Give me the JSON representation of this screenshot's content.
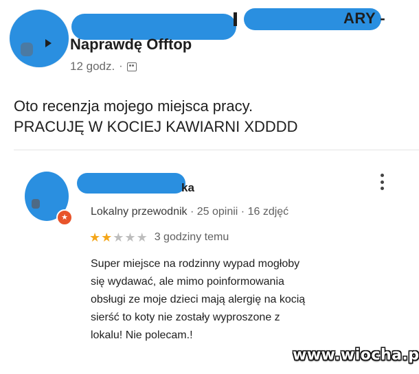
{
  "post": {
    "group_name_tail": "ARY -",
    "group_name": "Naprawdę Offtop",
    "time": "12 godz.",
    "separator": "·",
    "audience_icon": "group-icon",
    "body_lines": [
      "Oto recenzja mojego miejsca pracy.",
      "PRACUJĘ W KOCIEJ KAWIARNI XDDDD"
    ]
  },
  "review": {
    "reviewer_name_tail": "ka",
    "reviewer_badge": "Lokalny przewodnik",
    "reviewer_stats": "· 25 opinii · 16 zdjęć",
    "rating": 2,
    "rating_max": 5,
    "time": "3 godziny temu",
    "text_lines": [
      "Super miejsce na rodzinny wypad mogłoby",
      "się wydawać, ale mimo poinformowania",
      "obsługi ze moje dzieci mają alergię na kocią",
      "sierść to koty nie zostały wyproszone z",
      "lokalu! Nie polecam.!"
    ],
    "more_icon": "more-vertical-icon"
  },
  "watermark": "www.wiocha.pl",
  "colors": {
    "redaction": "#2a8fe0",
    "star_filled": "#f4a61a",
    "star_empty": "#bdbdbd"
  }
}
